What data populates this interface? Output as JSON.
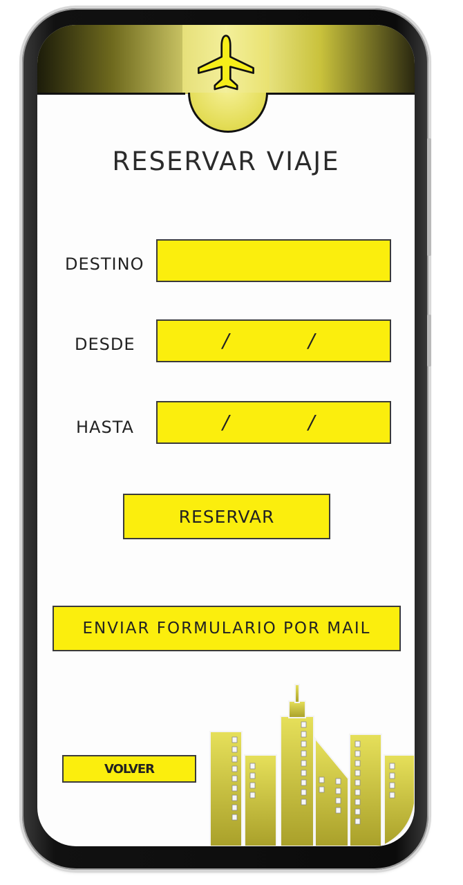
{
  "header": {
    "icon": "airplane-icon",
    "accent_color": "#fbee0d"
  },
  "title": "RESERVAR VIAJE",
  "form": {
    "destino_label": "DESTINO",
    "destino_value": "",
    "desde_label": "DESDE",
    "desde_sep1": "/",
    "desde_sep2": "/",
    "hasta_label": "HASTA",
    "hasta_sep1": "/",
    "hasta_sep2": "/"
  },
  "buttons": {
    "reservar": "RESERVAR",
    "enviar_mail": "ENVIAR FORMULARIO POR MAIL",
    "volver": "VOLVER"
  },
  "footer": {
    "illustration": "city-buildings-icon"
  }
}
